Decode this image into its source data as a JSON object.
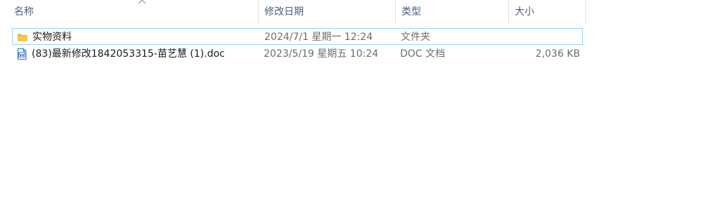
{
  "columns": {
    "name": "名称",
    "date": "修改日期",
    "type": "类型",
    "size": "大小"
  },
  "sort": {
    "column": "name",
    "direction": "ascending",
    "icon": "chevron-up-icon"
  },
  "files": [
    {
      "name": "实物资料",
      "modified": "2024/7/1 星期一 12:24",
      "type": "文件夹",
      "size": "",
      "icon": "folder-icon",
      "selected": true
    },
    {
      "name": "(83)最新修改1842053315-苗艺慧 (1).doc",
      "modified": "2023/5/19 星期五 10:24",
      "type": "DOC 文档",
      "size": "2,036 KB",
      "icon": "word-document-icon",
      "selected": false
    }
  ],
  "colors": {
    "header_text": "#4c607a",
    "selection_border": "#99d1ff",
    "folder": "#f8c64a",
    "word_blue": "#2b6cc4"
  }
}
